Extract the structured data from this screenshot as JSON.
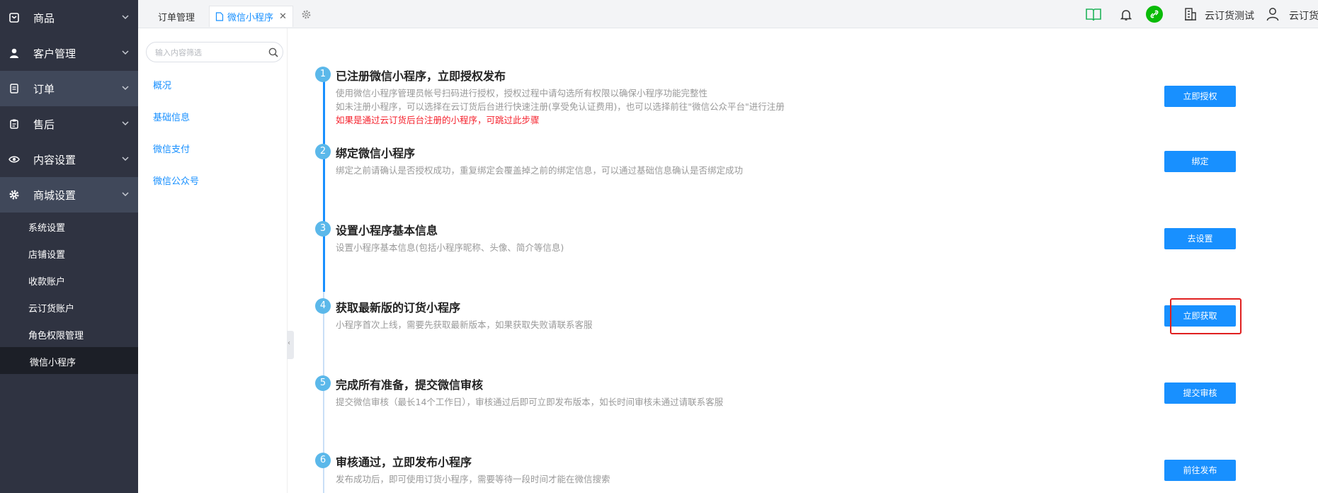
{
  "sidebar": {
    "items": [
      {
        "label": "商品",
        "icon": "box-icon"
      },
      {
        "label": "客户管理",
        "icon": "user-icon"
      },
      {
        "label": "订单",
        "icon": "list-icon"
      },
      {
        "label": "售后",
        "icon": "clipboard-icon"
      },
      {
        "label": "内容设置",
        "icon": "eye-icon"
      },
      {
        "label": "商城设置",
        "icon": "gear-icon"
      }
    ],
    "submenu": [
      "系统设置",
      "店铺设置",
      "收款账户",
      "云订货账户",
      "角色权限管理",
      "微信小程序"
    ],
    "active_sub": "微信小程序"
  },
  "tabs": [
    {
      "label": "订单管理",
      "active": false
    },
    {
      "label": "微信小程序",
      "active": true
    }
  ],
  "header": {
    "account_name": "云订货测试",
    "user_name": "云订货",
    "colors": {
      "book": "#21b35a",
      "link_circle": "#09bb07"
    }
  },
  "subnav": {
    "search_placeholder": "输入内容筛选",
    "links": [
      "概况",
      "基础信息",
      "微信支付",
      "微信公众号"
    ]
  },
  "steps": [
    {
      "num": "1",
      "title": "已注册微信小程序，立即授权发布",
      "desc": [
        "使用微信小程序管理员帐号扫码进行授权，授权过程中请勾选所有权限以确保小程序功能完整性",
        "如未注册小程序，可以选择在云订货后台进行快速注册(享受免认证费用)，也可以选择前往\"微信公众平台\"进行注册"
      ],
      "note": "如果是通过云订货后台注册的小程序，可跳过此步骤",
      "button": "立即授权"
    },
    {
      "num": "2",
      "title": "绑定微信小程序",
      "desc": [
        "绑定之前请确认是否授权成功，重复绑定会覆盖掉之前的绑定信息，可以通过基础信息确认是否绑定成功"
      ],
      "button": "绑定"
    },
    {
      "num": "3",
      "title": "设置小程序基本信息",
      "desc": [
        "设置小程序基本信息(包括小程序昵称、头像、简介等信息)"
      ],
      "button": "去设置"
    },
    {
      "num": "4",
      "title": "获取最新版的订货小程序",
      "desc": [
        "小程序首次上线，需要先获取最新版本，如果获取失败请联系客服"
      ],
      "button": "立即获取"
    },
    {
      "num": "5",
      "title": "完成所有准备，提交微信审核",
      "desc": [
        "提交微信审核（最长14个工作日），审核通过后即可立即发布版本，如长时间审核未通过请联系客服"
      ],
      "button": "提交审核"
    },
    {
      "num": "6",
      "title": "审核通过，立即发布小程序",
      "desc": [
        "发布成功后，即可使用订货小程序，需要等待一段时间才能在微信搜索"
      ],
      "button": "前往发布"
    }
  ],
  "theme": {
    "primary": "#1890ff",
    "sidebar_bg": "#2f3341",
    "step_circle": "#5bb8ea",
    "warning_text": "#f5222d"
  }
}
